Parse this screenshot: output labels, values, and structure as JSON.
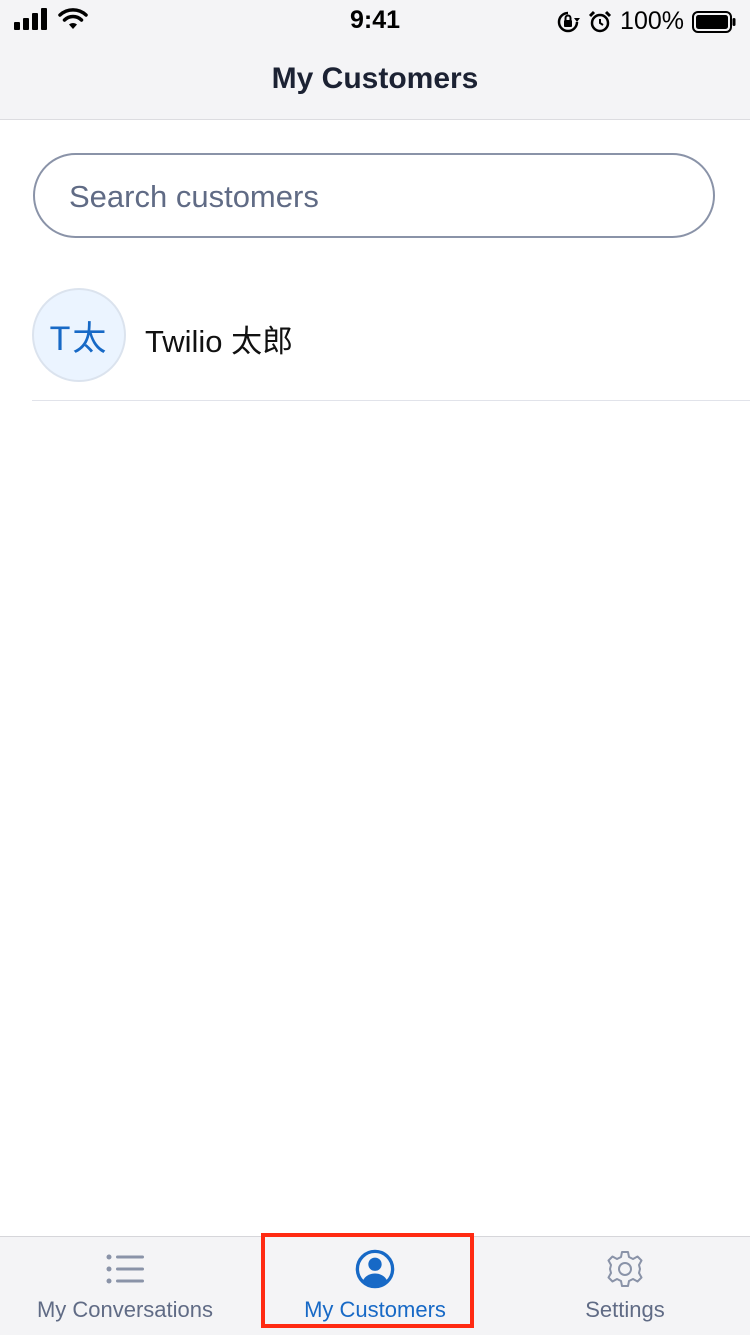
{
  "status_bar": {
    "time": "9:41",
    "battery_percent": "100%",
    "battery_level": 1.0,
    "icons": [
      "cellular-signal-icon",
      "wifi-icon",
      "orientation-lock-icon",
      "alarm-icon",
      "battery-icon"
    ]
  },
  "nav": {
    "title": "My Customers"
  },
  "search": {
    "placeholder": "Search customers",
    "value": ""
  },
  "customers": [
    {
      "initials": "T太",
      "name": "Twilio 太郎"
    }
  ],
  "tabs": [
    {
      "label": "My Conversations",
      "icon": "list-icon",
      "active": false
    },
    {
      "label": "My Customers",
      "icon": "user-circle-icon",
      "active": true
    },
    {
      "label": "Settings",
      "icon": "gear-icon",
      "active": false
    }
  ],
  "colors": {
    "accent": "#1769c6",
    "inactive": "#606b85",
    "highlight": "#ff2a12",
    "bar_background": "#f4f4f6"
  }
}
